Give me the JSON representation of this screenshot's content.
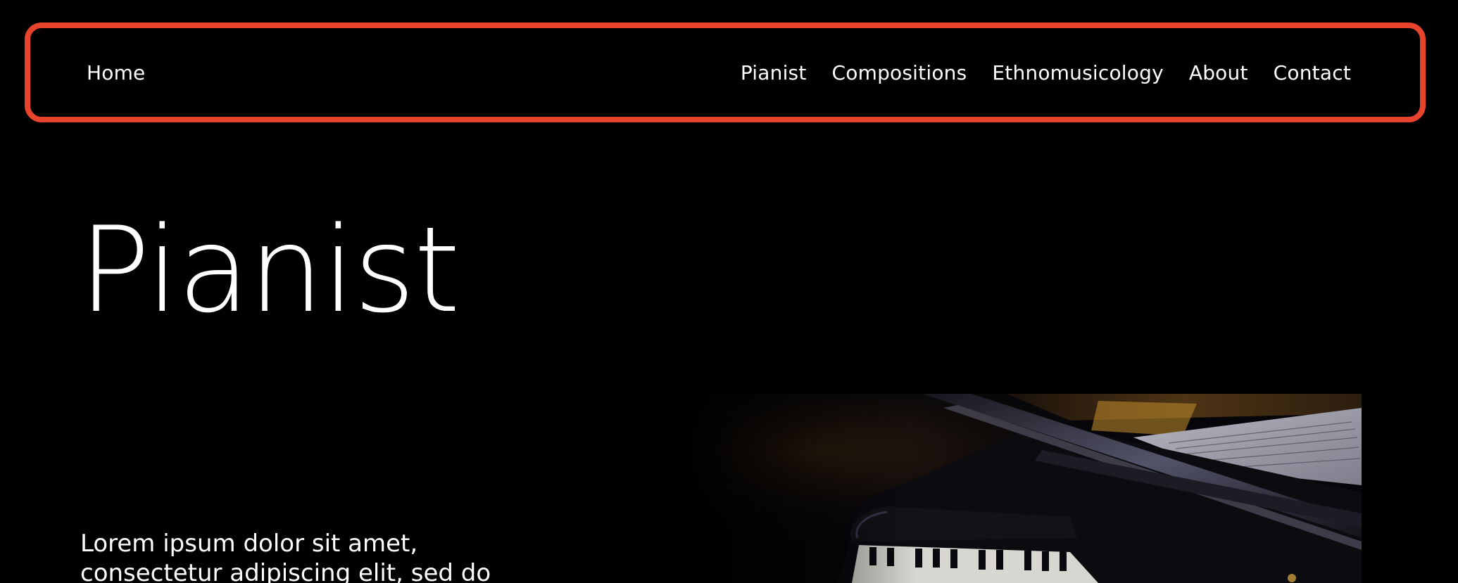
{
  "nav": {
    "home_label": "Home",
    "links": [
      {
        "label": "Pianist"
      },
      {
        "label": "Compositions"
      },
      {
        "label": "Ethnomusicology"
      },
      {
        "label": "About"
      },
      {
        "label": "Contact"
      }
    ],
    "border_color": "#e8432d"
  },
  "hero": {
    "title": "Pianist",
    "text": "Lorem ipsum dolor sit amet, consectetur adipiscing elit, sed do",
    "image_icon": "grand-piano-photo"
  },
  "colors": {
    "background": "#000000",
    "text": "#ffffff",
    "accent": "#e8432d"
  }
}
